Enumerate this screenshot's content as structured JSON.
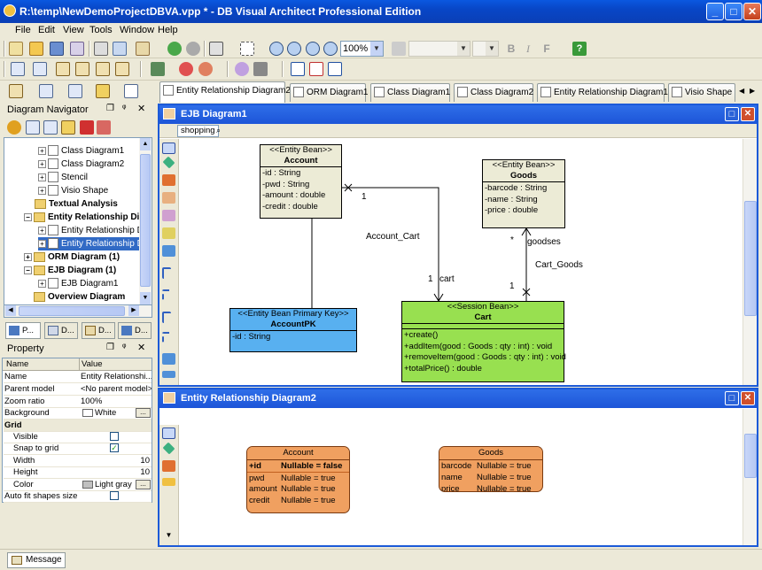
{
  "window": {
    "title": "R:\\temp\\NewDemoProjectDBVA.vpp * - DB Visual Architect Professional Edition"
  },
  "menu": [
    "File",
    "Edit",
    "View",
    "Tools",
    "Window",
    "Help"
  ],
  "toolbar": {
    "zoom": "100%"
  },
  "navigator": {
    "title": "Diagram Navigator",
    "tree": [
      {
        "label": "Class Diagram1",
        "bold": false
      },
      {
        "label": "Class Diagram2",
        "bold": false
      },
      {
        "label": "Stencil",
        "bold": false
      },
      {
        "label": "Visio Shape",
        "bold": false
      },
      {
        "label": "Textual Analysis",
        "bold": true
      },
      {
        "label": "Entity Relationship Diag",
        "bold": true
      },
      {
        "label": "Entity Relationship Di",
        "bold": false
      },
      {
        "label": "Entity Relationship Di",
        "bold": false
      },
      {
        "label": "ORM Diagram (1)",
        "bold": true
      },
      {
        "label": "EJB Diagram (1)",
        "bold": true
      },
      {
        "label": "EJB Diagram1",
        "bold": false
      },
      {
        "label": "Overview Diagram",
        "bold": true
      }
    ]
  },
  "panel_tabs": [
    "P...",
    "D...",
    "D...",
    "D..."
  ],
  "property": {
    "title": "Property",
    "headers": [
      "Name",
      "Value"
    ],
    "rows": [
      {
        "name": "Name",
        "value": "Entity Relationshi..."
      },
      {
        "name": "Parent model",
        "value": "<No parent model>"
      },
      {
        "name": "Zoom ratio",
        "value": "100%"
      },
      {
        "name": "Background",
        "value": "White"
      },
      {
        "name": "Grid",
        "value": ""
      },
      {
        "name": "Visible",
        "value": ""
      },
      {
        "name": "Snap to grid",
        "value": ""
      },
      {
        "name": "Width",
        "value": "10"
      },
      {
        "name": "Height",
        "value": "10"
      },
      {
        "name": "Color",
        "value": "Light gray"
      },
      {
        "name": "Auto fit shapes size",
        "value": ""
      }
    ]
  },
  "tabs": [
    "Entity Relationship Diagram2",
    "ORM Diagram1",
    "Class Diagram1",
    "Class Diagram2",
    "Entity Relationship Diagram1",
    "Visio Shape"
  ],
  "ejb": {
    "title": "EJB Diagram1",
    "breadcrumb": "shopping",
    "account": {
      "stereo": "<<Entity Bean>>",
      "name": "Account",
      "attrs": [
        "-id : String",
        "-pwd : String",
        "-amount : double",
        "-credit : double"
      ]
    },
    "goods": {
      "stereo": "<<Entity Bean>>",
      "name": "Goods",
      "attrs": [
        "-barcode : String",
        "-name : String",
        "-price : double"
      ]
    },
    "accountpk": {
      "stereo": "<<Entity Bean Primary Key>>",
      "name": "AccountPK",
      "attrs": [
        "-id : String"
      ]
    },
    "cart": {
      "stereo": "<<Session Bean>>",
      "name": "Cart",
      "ops": [
        "+create()",
        "+addItem(good : Goods : qty : int) : void",
        "+removeItem(good : Goods : qty : int) : void",
        "+totalPrice() : double"
      ]
    },
    "labels": {
      "account_cart": "Account_Cart",
      "m1a": "1",
      "m1b": "1",
      "cart": "cart",
      "cart_goods": "Cart_Goods",
      "goodses": "goodses",
      "star": "*",
      "m1c": "1"
    }
  },
  "erd": {
    "title": "Entity Relationship Diagram2",
    "account": {
      "name": "Account",
      "rows": [
        {
          "c": "+id",
          "v": "Nullable = false",
          "b": true
        },
        {
          "c": "pwd",
          "v": "Nullable = true",
          "b": false
        },
        {
          "c": "amount",
          "v": "Nullable = true",
          "b": false
        },
        {
          "c": "credit",
          "v": "Nullable = true",
          "b": false
        }
      ]
    },
    "goods": {
      "name": "Goods",
      "rows": [
        {
          "c": "barcode",
          "v": "Nullable = true"
        },
        {
          "c": "name",
          "v": "Nullable = true"
        },
        {
          "c": "price",
          "v": "Nullable = true"
        }
      ]
    }
  },
  "status": {
    "message": "Message"
  }
}
